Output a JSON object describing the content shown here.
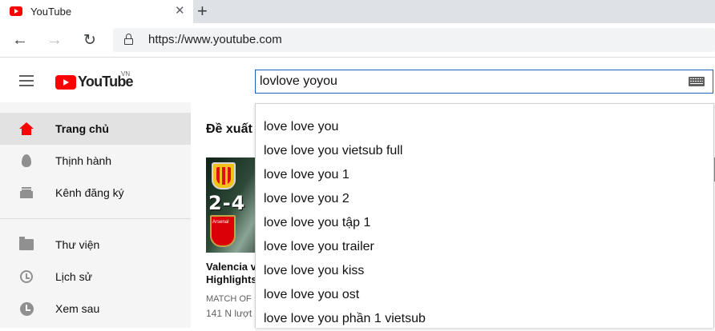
{
  "browser": {
    "tab_title": "YouTube",
    "tab_close": "✕",
    "new_tab": "+",
    "back": "←",
    "forward": "→",
    "reload": "↻",
    "url": "https://www.youtube.com"
  },
  "masthead": {
    "logo_text": "YouTube",
    "region": "VN",
    "search_value": "lovlove yoyou"
  },
  "sidebar": {
    "items": [
      {
        "label": "Trang chủ",
        "icon": "home-icon"
      },
      {
        "label": "Thịnh hành",
        "icon": "fire-icon"
      },
      {
        "label": "Kênh đăng ký",
        "icon": "subscriptions-icon"
      },
      {
        "label": "Thư viện",
        "icon": "folder-icon"
      },
      {
        "label": "Lịch sử",
        "icon": "history-icon"
      },
      {
        "label": "Xem sau",
        "icon": "clock-icon"
      }
    ]
  },
  "main": {
    "section_title": "Đề xuất",
    "video": {
      "score": "2-4",
      "title_line1": "Valencia v",
      "title_line2": "Highlights",
      "channel": "MATCH OF",
      "views": "141 N lượt"
    }
  },
  "suggestions": [
    "love love you",
    "love love you vietsub full",
    "love love you 1",
    "love love you 2",
    "love love you tập 1",
    "love love you trailer",
    "love love you kiss",
    "love love you ost",
    "love love you phần 1 vietsub"
  ],
  "colors": {
    "brand_red": "#ff0000",
    "search_border": "#1c62b9",
    "sidebar_bg": "#f5f5f5",
    "active_item_bg": "#e2e2e2"
  }
}
